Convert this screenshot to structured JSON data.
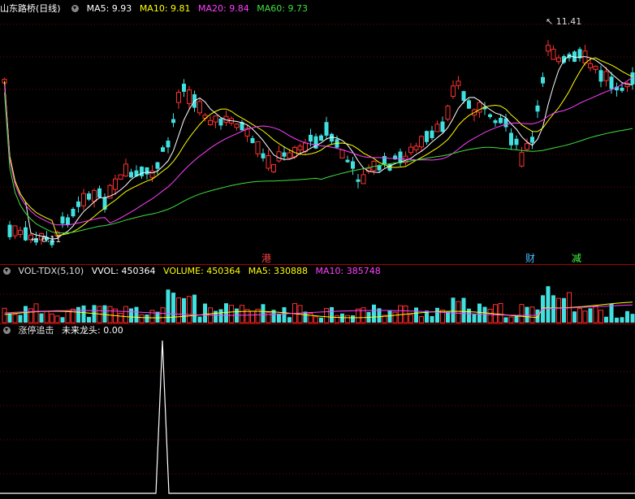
{
  "main": {
    "title": "山东路桥(日线)",
    "ma": [
      {
        "label": "MA5: 9.93",
        "color": "#ffffff"
      },
      {
        "label": "MA10: 9.81",
        "color": "#ffff00"
      },
      {
        "label": "MA20: 9.84",
        "color": "#ff40ff"
      },
      {
        "label": "MA60: 9.73",
        "color": "#40e040"
      }
    ],
    "high_label": "11.41",
    "low_label": "6.11",
    "markers": [
      {
        "text": "港",
        "color": "#ff4040"
      },
      {
        "text": "财",
        "color": "#40c0ff"
      },
      {
        "text": "减",
        "color": "#40ff40"
      }
    ]
  },
  "volume": {
    "title": "VOL-TDX(5,10)",
    "items": [
      {
        "label": "VVOL: 450364",
        "color": "#ffffff"
      },
      {
        "label": "VOLUME: 450364",
        "color": "#ffff00"
      },
      {
        "label": "MA5: 330888",
        "color": "#ffff00"
      },
      {
        "label": "MA10: 385748",
        "color": "#ff40ff"
      }
    ]
  },
  "indicator": {
    "title": "涨停追击",
    "items": [
      {
        "label": "未来龙头: 0.00",
        "color": "#ffffff"
      }
    ]
  },
  "colors": {
    "up": "#ff3030",
    "down": "#40e0e0",
    "grid": "#800000"
  }
}
